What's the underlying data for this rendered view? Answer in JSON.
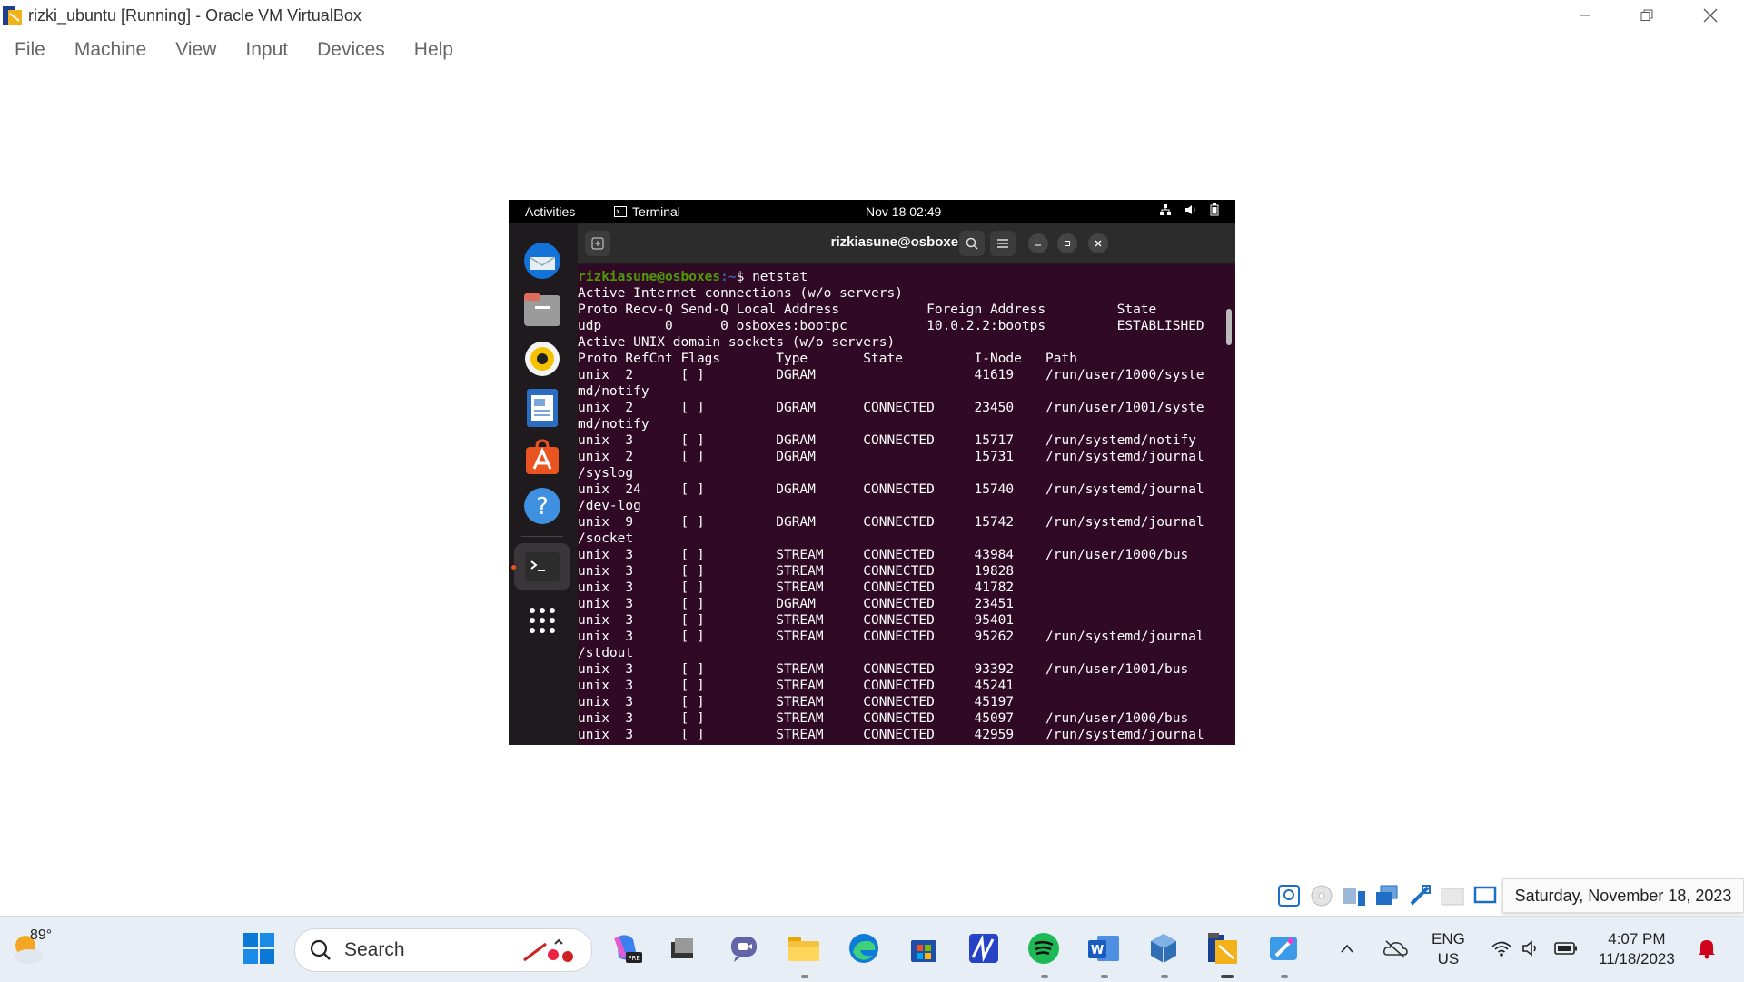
{
  "window": {
    "title": "rizki_ubuntu [Running] - Oracle VM VirtualBox",
    "menu": [
      "File",
      "Machine",
      "View",
      "Input",
      "Devices",
      "Help"
    ]
  },
  "gnome": {
    "activities": "Activities",
    "app_name": "Terminal",
    "clock": "Nov 18  02:49"
  },
  "terminal": {
    "title": "rizkiasune@osboxes: ~",
    "prompt_user": "rizkiasune@osboxes",
    "prompt_path": ":~",
    "command": "$ netstat",
    "lines": [
      "Active Internet connections (w/o servers)",
      "Proto Recv-Q Send-Q Local Address           Foreign Address         State",
      "udp        0      0 osboxes:bootpc          10.0.2.2:bootps         ESTABLISHED",
      "Active UNIX domain sockets (w/o servers)",
      "Proto RefCnt Flags       Type       State         I-Node   Path",
      "unix  2      [ ]         DGRAM                    41619    /run/user/1000/syste",
      "md/notify",
      "unix  2      [ ]         DGRAM      CONNECTED     23450    /run/user/1001/syste",
      "md/notify",
      "unix  3      [ ]         DGRAM      CONNECTED     15717    /run/systemd/notify",
      "unix  2      [ ]         DGRAM                    15731    /run/systemd/journal",
      "/syslog",
      "unix  24     [ ]         DGRAM      CONNECTED     15740    /run/systemd/journal",
      "/dev-log",
      "unix  9      [ ]         DGRAM      CONNECTED     15742    /run/systemd/journal",
      "/socket",
      "unix  3      [ ]         STREAM     CONNECTED     43984    /run/user/1000/bus",
      "unix  3      [ ]         STREAM     CONNECTED     19828",
      "unix  3      [ ]         STREAM     CONNECTED     41782",
      "unix  3      [ ]         DGRAM      CONNECTED     23451",
      "unix  3      [ ]         STREAM     CONNECTED     95401",
      "unix  3      [ ]         STREAM     CONNECTED     95262    /run/systemd/journal",
      "/stdout",
      "unix  3      [ ]         STREAM     CONNECTED     93392    /run/user/1001/bus",
      "unix  3      [ ]         STREAM     CONNECTED     45241",
      "unix  3      [ ]         STREAM     CONNECTED     45197",
      "unix  3      [ ]         STREAM     CONNECTED     45097    /run/user/1000/bus",
      "unix  3      [ ]         STREAM     CONNECTED     42959    /run/systemd/journal"
    ]
  },
  "tooltip": {
    "date": "Saturday, November 18, 2023"
  },
  "taskbar": {
    "weather_temp": "89°",
    "search_label": "Search",
    "lang_top": "ENG",
    "lang_bottom": "US",
    "time": "4:07 PM",
    "date": "11/18/2023"
  },
  "colors": {
    "terminal_bg": "#300a24",
    "prompt_user": "#4e9a06",
    "prompt_path": "#3465a4",
    "taskbar_bg": "#e8eef6"
  }
}
